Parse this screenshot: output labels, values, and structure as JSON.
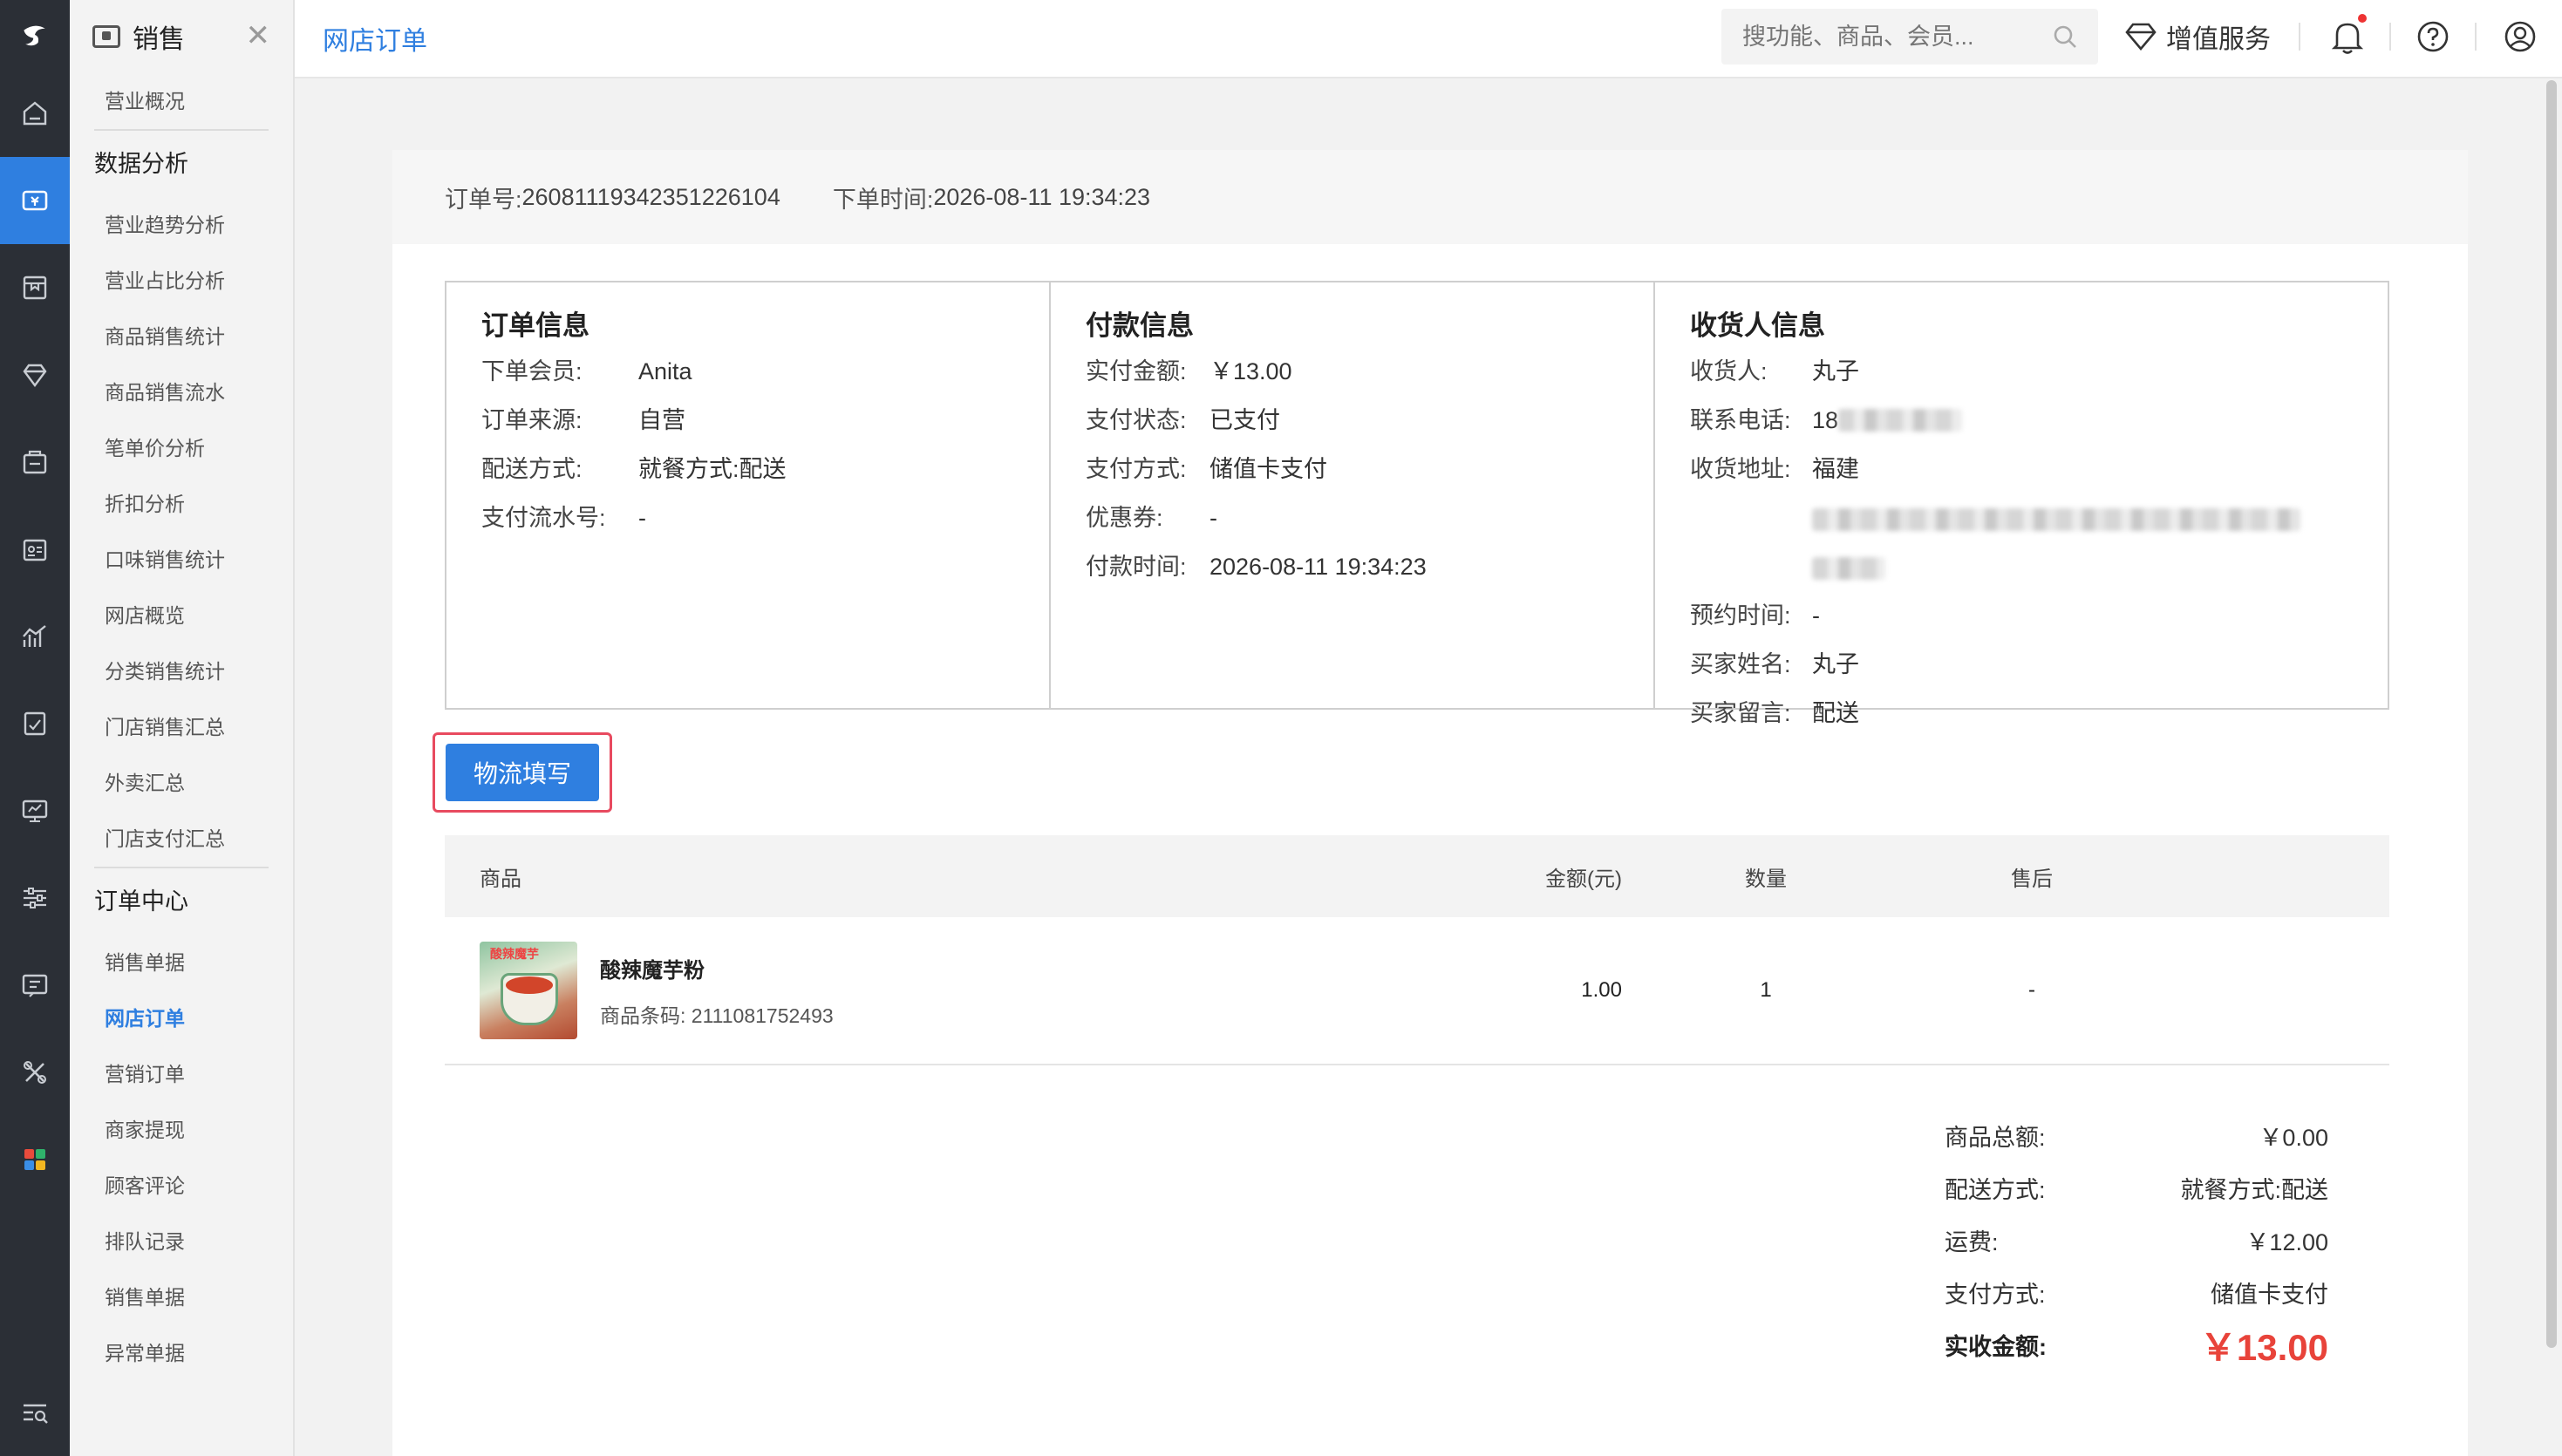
{
  "sidebar": {
    "module_title": "销售",
    "items": [
      {
        "type": "link",
        "label": "营业概况"
      },
      {
        "type": "group",
        "label": "数据分析"
      },
      {
        "type": "link",
        "label": "营业趋势分析"
      },
      {
        "type": "link",
        "label": "营业占比分析"
      },
      {
        "type": "link",
        "label": "商品销售统计"
      },
      {
        "type": "link",
        "label": "商品销售流水"
      },
      {
        "type": "link",
        "label": "笔单价分析"
      },
      {
        "type": "link",
        "label": "折扣分析"
      },
      {
        "type": "link",
        "label": "口味销售统计"
      },
      {
        "type": "link",
        "label": "网店概览"
      },
      {
        "type": "link",
        "label": "分类销售统计"
      },
      {
        "type": "link",
        "label": "门店销售汇总"
      },
      {
        "type": "link",
        "label": "外卖汇总"
      },
      {
        "type": "link",
        "label": "门店支付汇总"
      },
      {
        "type": "group",
        "label": "订单中心"
      },
      {
        "type": "link",
        "label": "销售单据"
      },
      {
        "type": "link",
        "label": "网店订单",
        "active": true
      },
      {
        "type": "link",
        "label": "营销订单"
      },
      {
        "type": "link",
        "label": "商家提现"
      },
      {
        "type": "link",
        "label": "顾客评论"
      },
      {
        "type": "link",
        "label": "排队记录"
      },
      {
        "type": "link",
        "label": "销售单据"
      },
      {
        "type": "link",
        "label": "异常单据"
      }
    ]
  },
  "topbar": {
    "page_title": "网店订单",
    "search_placeholder": "搜功能、商品、会员...",
    "vip_label": "增值服务"
  },
  "order": {
    "number_label": "订单号:",
    "number": "26081119342351226104",
    "time_label": "下单时间:",
    "time": "2026-08-11 19:34:23"
  },
  "order_info": {
    "title": "订单信息",
    "rows": [
      {
        "k": "下单会员:",
        "v": "Anita"
      },
      {
        "k": "订单来源:",
        "v": "自营"
      },
      {
        "k": "配送方式:",
        "v": "就餐方式:配送"
      },
      {
        "k": "支付流水号:",
        "v": "-"
      }
    ]
  },
  "payment_info": {
    "title": "付款信息",
    "rows": [
      {
        "k": "实付金额:",
        "v": "￥13.00"
      },
      {
        "k": "支付状态:",
        "v": "已支付"
      },
      {
        "k": "支付方式:",
        "v": "储值卡支付"
      },
      {
        "k": "优惠券:",
        "v": "-"
      },
      {
        "k": "付款时间:",
        "v": "2026-08-11 19:34:23"
      }
    ]
  },
  "receiver_info": {
    "title": "收货人信息",
    "name_label": "收货人:",
    "name": "丸子",
    "phone_label": "联系电话:",
    "phone_prefix": "18",
    "address_label": "收货地址:",
    "address_prefix": "福建",
    "appointment_label": "预约时间:",
    "appointment": "-",
    "buyer_label": "买家姓名:",
    "buyer": "丸子",
    "message_label": "买家留言:",
    "message": "配送"
  },
  "logistics_button": "物流填写",
  "table": {
    "headers": {
      "product": "商品",
      "amount": "金额(元)",
      "qty": "数量",
      "after_sale": "售后"
    },
    "rows": [
      {
        "thumb_text": "酸辣魔芋",
        "name": "酸辣魔芋粉",
        "code_label": "商品条码:",
        "code": "2111081752493",
        "amount": "1.00",
        "qty": "1",
        "after_sale": "-"
      }
    ]
  },
  "summary": {
    "rows": [
      {
        "k": "商品总额:",
        "v": "￥0.00"
      },
      {
        "k": "配送方式:",
        "v": "就餐方式:配送"
      },
      {
        "k": "运费:",
        "v": "￥12.00"
      },
      {
        "k": "支付方式:",
        "v": "储值卡支付"
      }
    ],
    "total_label": "实收金额:",
    "total": "￥13.00"
  },
  "colors": {
    "accent": "#2f7fe0",
    "rail": "#2b2f36",
    "total": "#e8433a",
    "highlight_border": "#e84a5f"
  }
}
